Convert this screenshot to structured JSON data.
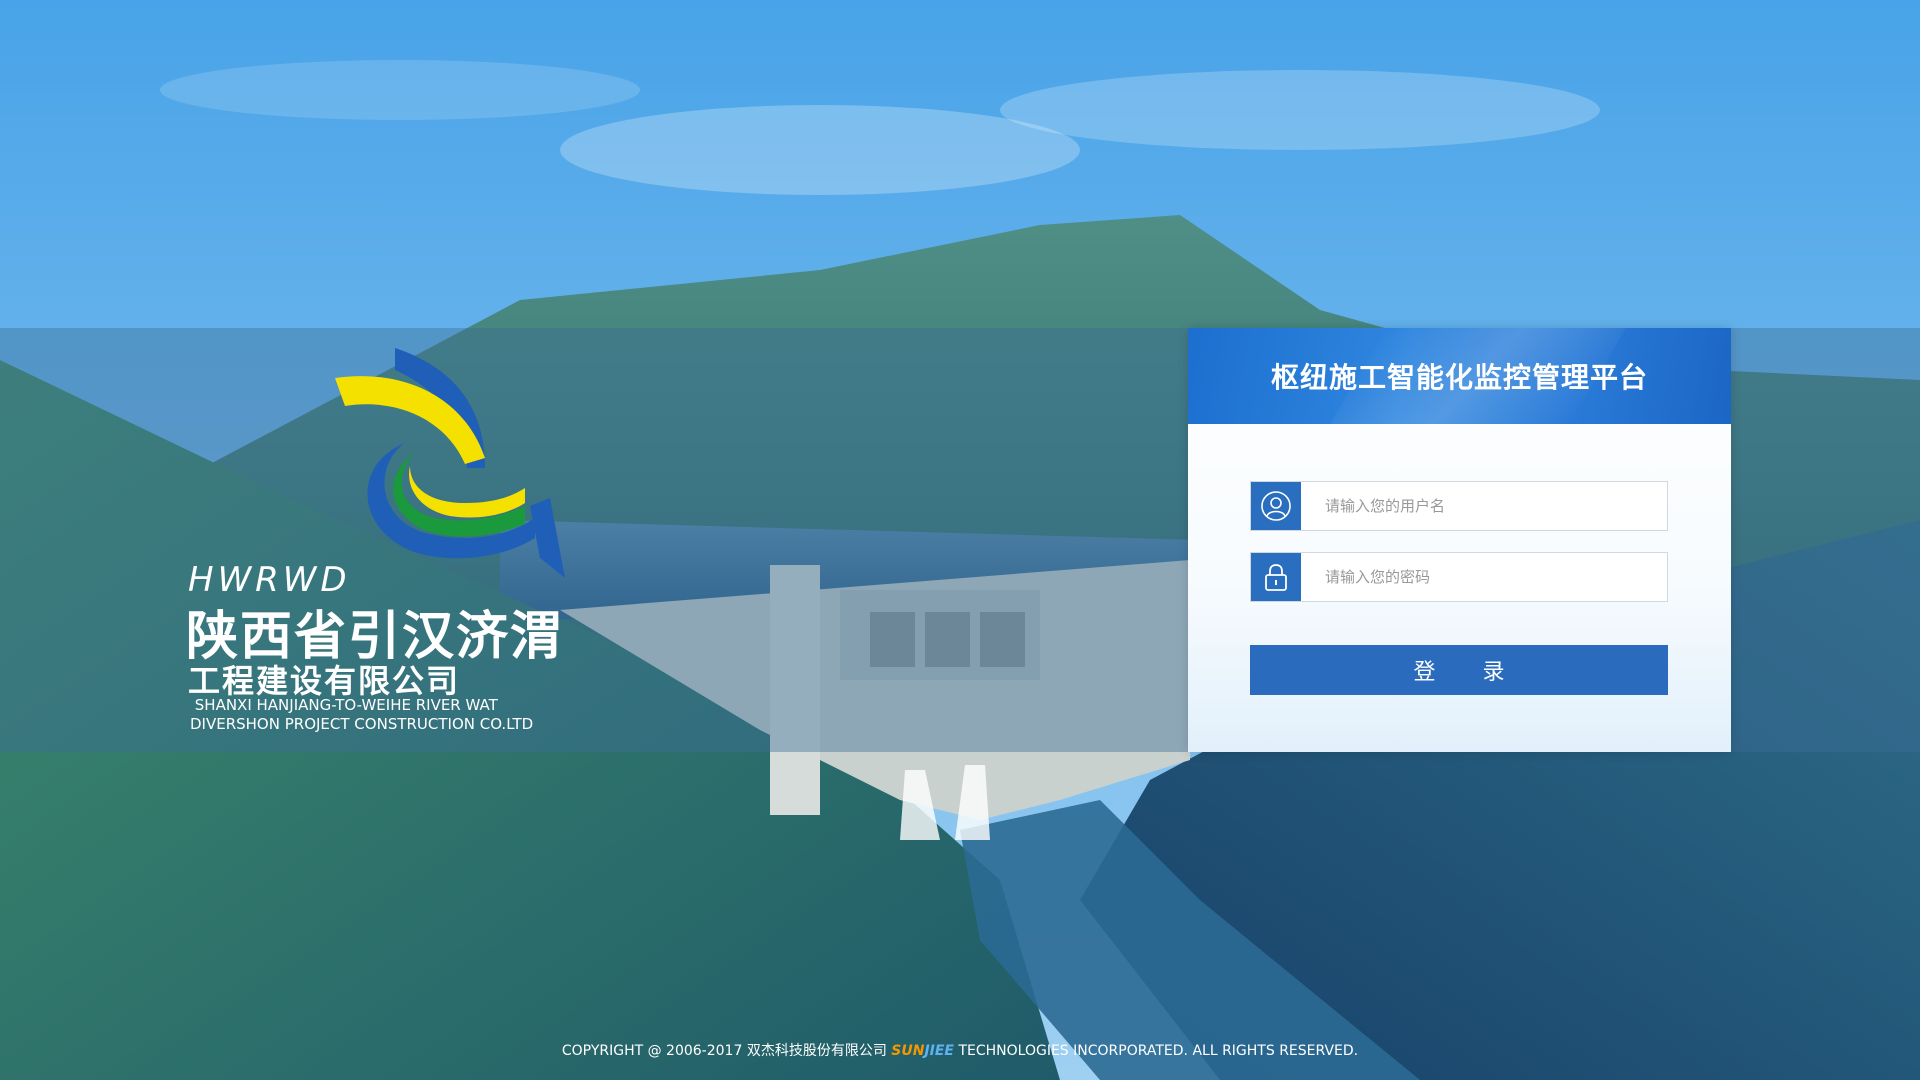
{
  "company": {
    "abbr": "HWRWD",
    "name_cn_line1": "陕西省引汉济渭",
    "name_cn_line2": "工程建设有限公司",
    "name_en": " SHANXI HANJIANG-TO-WEIHE RIVER WAT\nDIVERSHON PROJECT CONSTRUCTION CO.LTD"
  },
  "login": {
    "title": "枢纽施工智能化监控管理平台",
    "username_placeholder": "请输入您的用户名",
    "password_placeholder": "请输入您的密码",
    "submit_label": "登 录"
  },
  "footer": {
    "copyright_prefix": "COPYRIGHT @ 2006-2017 双杰科技股份有限公司",
    "brand_sun": "SUN",
    "brand_jet": "JIEE",
    "copyright_suffix": "TECHNOLOGIES INCORPORATED. ALL RIGHTS RESERVED."
  },
  "colors": {
    "accent": "#2a6bbd",
    "header_blue": "#1d6fcf",
    "logo_yellow": "#f5e100",
    "logo_blue": "#1f5fb8",
    "logo_green": "#1a9a3c"
  },
  "icons": {
    "user": "user-icon",
    "lock": "lock-icon"
  }
}
